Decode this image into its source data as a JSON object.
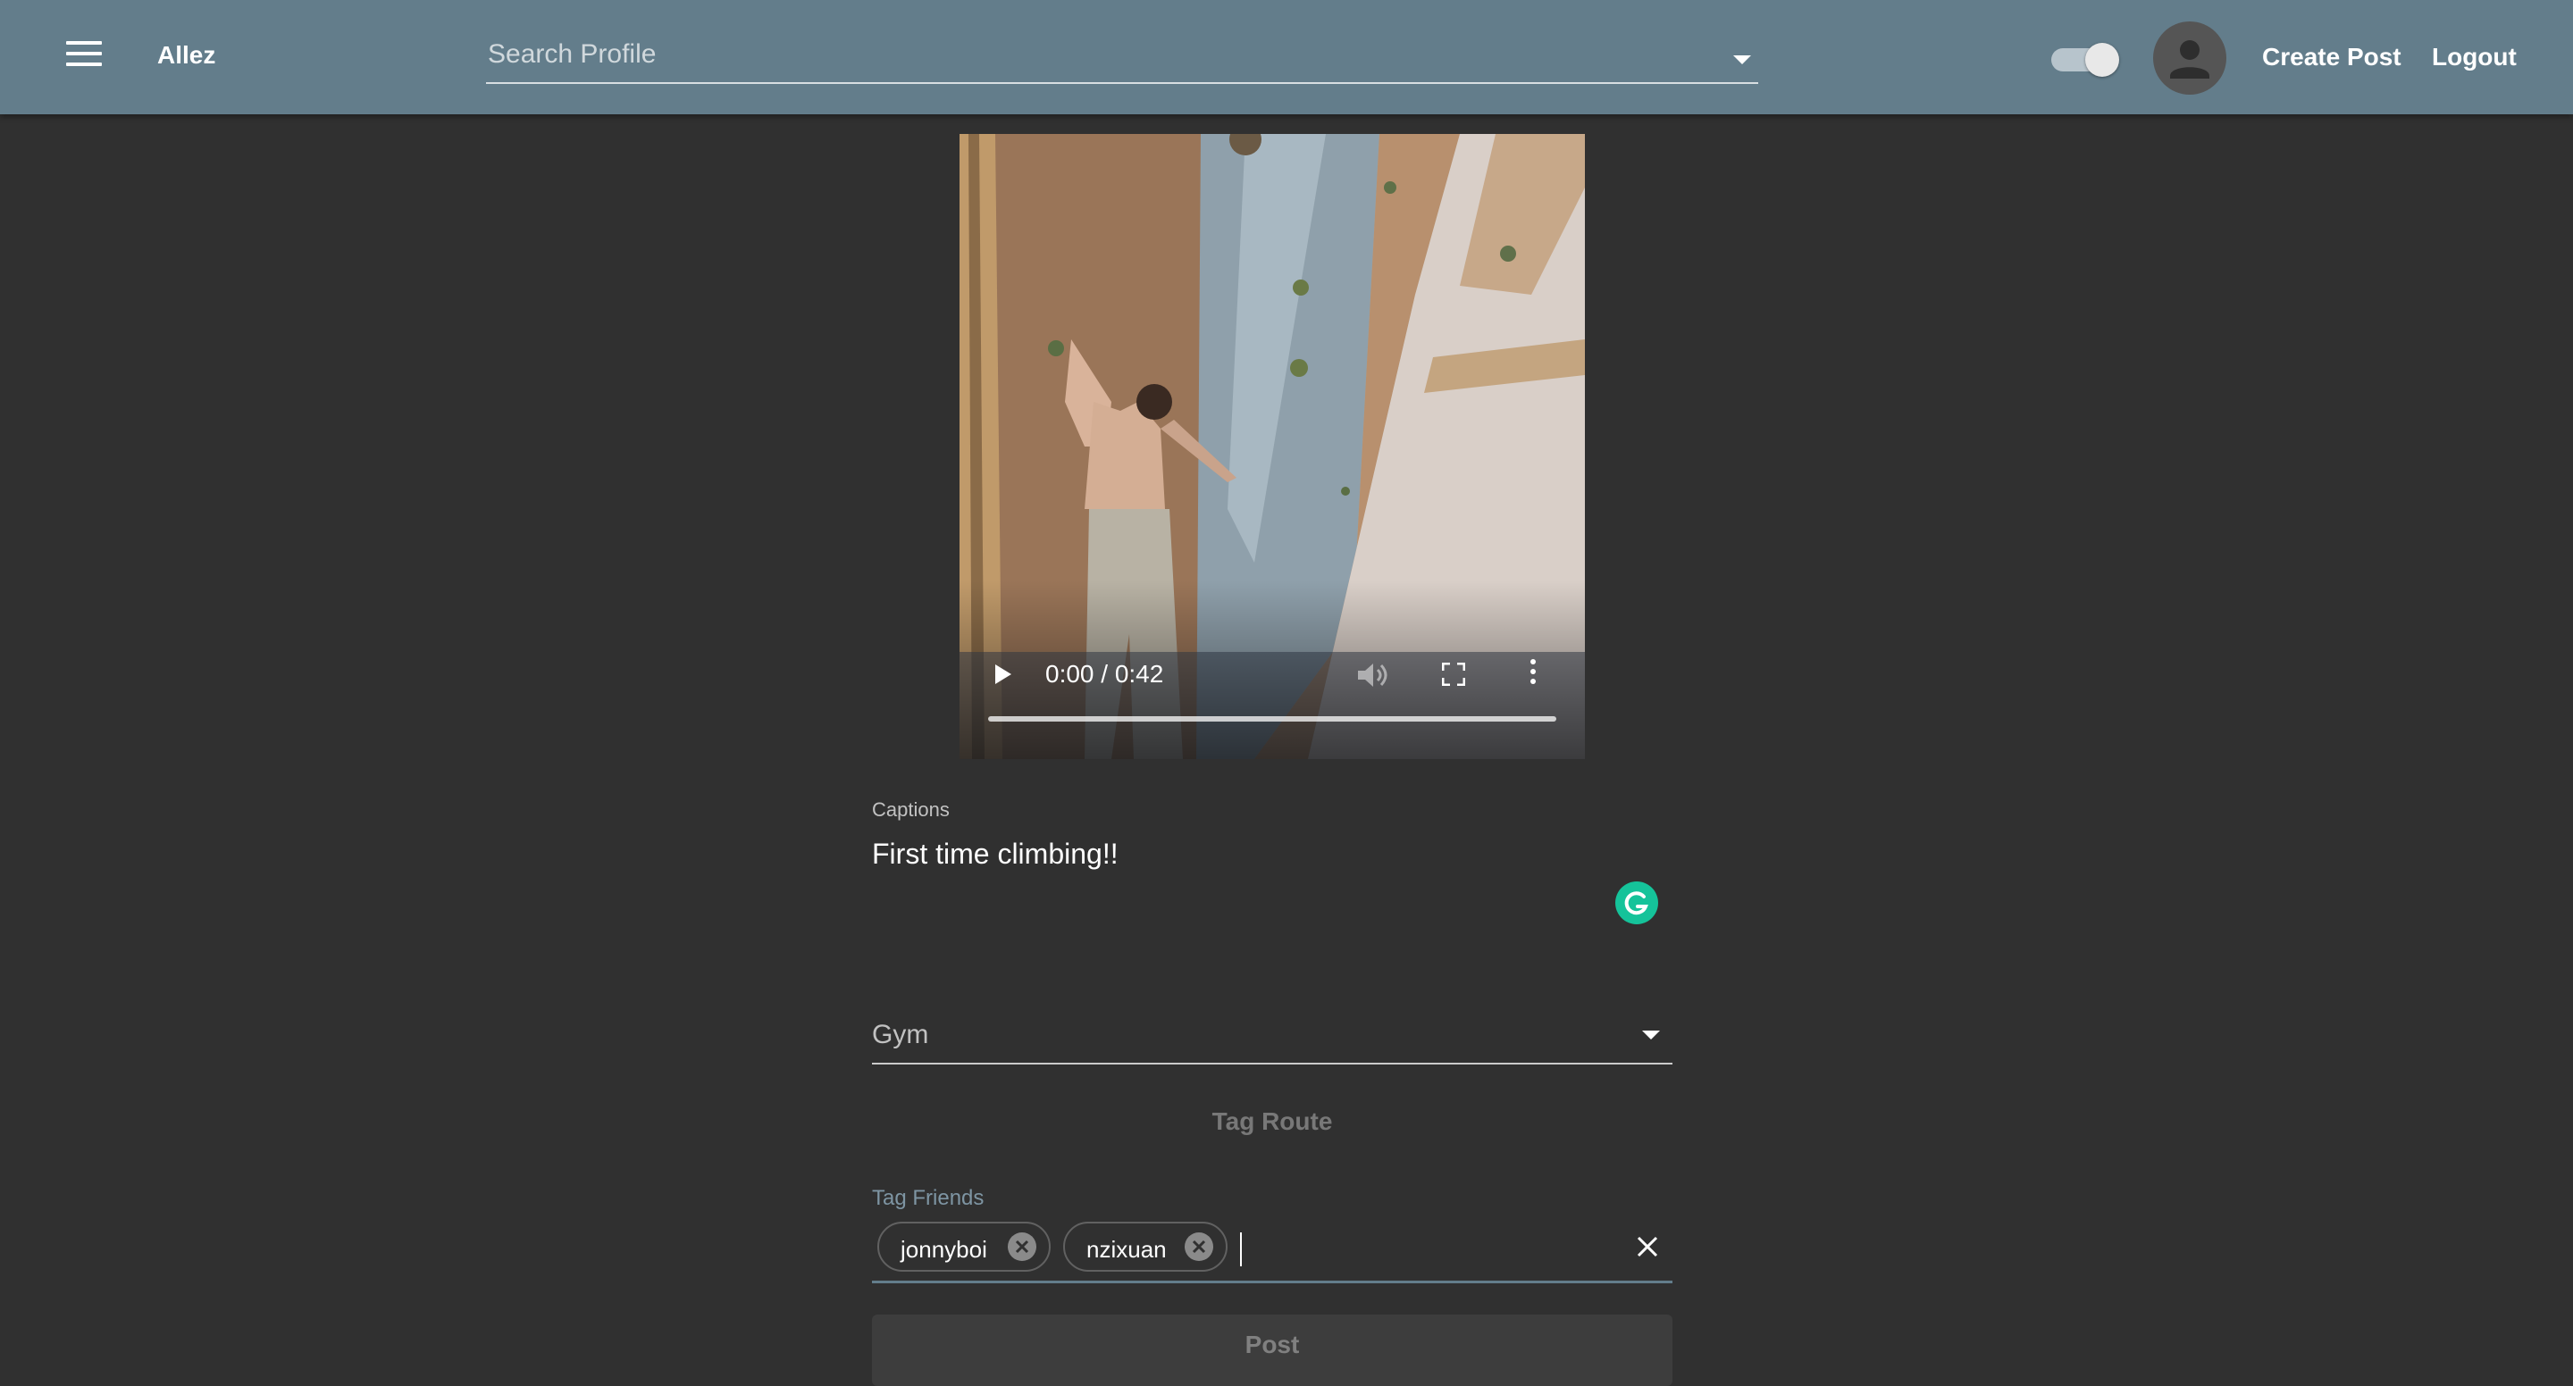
{
  "appbar": {
    "brand": "Allez",
    "search_placeholder": "Search Profile",
    "create_post": "Create Post",
    "logout": "Logout"
  },
  "video": {
    "time": "0:00 / 0:42"
  },
  "captions": {
    "label": "Captions",
    "value": "First time climbing!!"
  },
  "gym": {
    "label": "Gym"
  },
  "tag_route": "Tag Route",
  "tag_friends": {
    "label": "Tag Friends",
    "chips": [
      "jonnyboi",
      "nzixuan"
    ]
  },
  "post_button": "Post"
}
